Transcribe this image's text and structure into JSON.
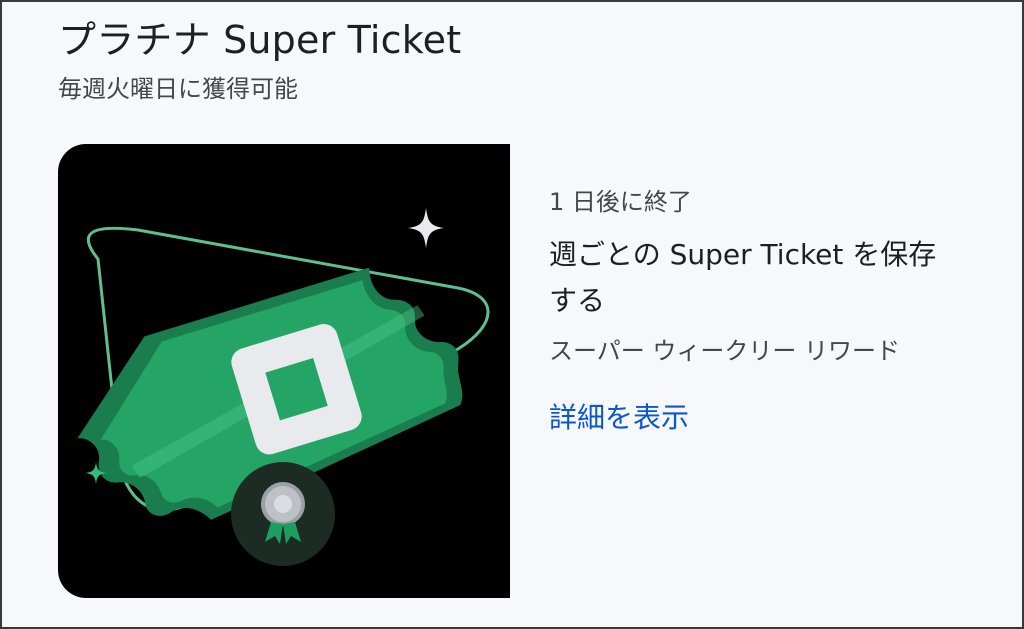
{
  "header": {
    "title": "プラチナ Super Ticket",
    "subtitle": "毎週火曜日に獲得可能"
  },
  "reward": {
    "expiry": "1 日後に終了",
    "title": "週ごとの Super Ticket を保存する",
    "subtitle": "スーパー ウィークリー リワード",
    "details_link": "詳細を表示",
    "image_icons": [
      "ticket-icon",
      "badge-icon",
      "sparkle-icon"
    ]
  },
  "colors": {
    "background": "#f6f8fc",
    "title_text": "#1f1f1f",
    "secondary_text": "#444746",
    "link": "#0b57d0",
    "ticket_green": "#1e9e5e",
    "image_background": "#000000"
  }
}
